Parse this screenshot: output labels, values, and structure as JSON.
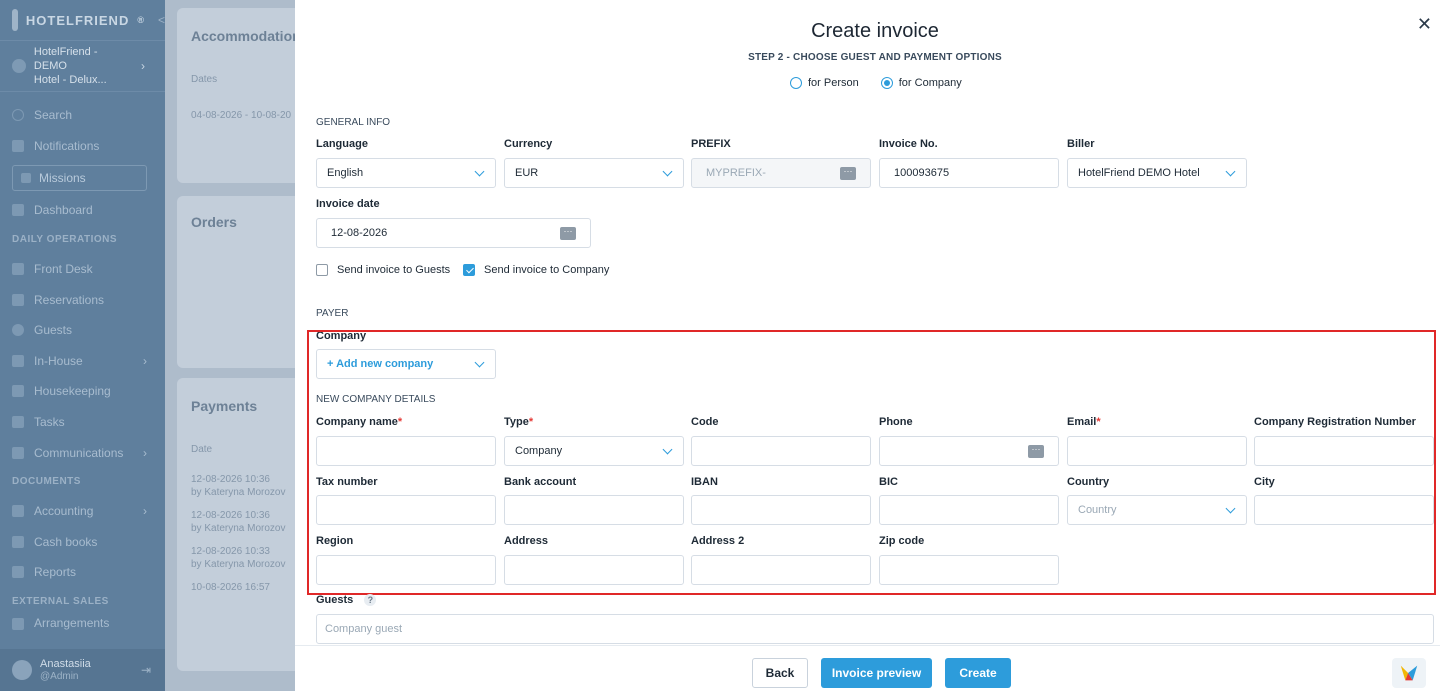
{
  "app": {
    "logo_text": "HOTELFRIEND",
    "logo_suffix": "®"
  },
  "sidebar": {
    "hotel": "HotelFriend - DEMO Hotel - Delux...",
    "hotel_line1": "HotelFriend - DEMO",
    "hotel_line2": "Hotel - Delux...",
    "items_top": [
      {
        "label": "Search",
        "icon": "search-icon"
      },
      {
        "label": "Notifications",
        "icon": "bell-icon"
      }
    ],
    "missions": "Missions",
    "dashboard": "Dashboard",
    "section_daily": "DAILY OPERATIONS",
    "items_daily": [
      {
        "label": "Front Desk",
        "icon": "front-desk-icon"
      },
      {
        "label": "Reservations",
        "icon": "calendar-icon"
      },
      {
        "label": "Guests",
        "icon": "user-icon"
      },
      {
        "label": "In-House",
        "icon": "bed-icon",
        "chevron": true
      },
      {
        "label": "Housekeeping",
        "icon": "broom-icon"
      },
      {
        "label": "Tasks",
        "icon": "wrench-icon"
      },
      {
        "label": "Communications",
        "icon": "chat-icon",
        "chevron": true
      }
    ],
    "section_documents": "DOCUMENTS",
    "items_documents": [
      {
        "label": "Accounting",
        "icon": "chart-icon",
        "chevron": true
      },
      {
        "label": "Cash books",
        "icon": "book-icon"
      },
      {
        "label": "Reports",
        "icon": "report-icon"
      }
    ],
    "section_external": "EXTERNAL SALES",
    "items_external": [
      {
        "label": "Arrangements",
        "icon": "arrangement-icon"
      }
    ],
    "user": {
      "name": "Anastasiia",
      "role": "@Admin"
    }
  },
  "background": {
    "accommodation": {
      "title": "Accommodation",
      "head": "Dates",
      "row": "04-08-2026 - 10-08-20"
    },
    "orders": {
      "title": "Orders"
    },
    "payments": {
      "title": "Payments",
      "head": "Date",
      "rows": [
        {
          "date": "12-08-2026 10:36",
          "by": "by Kateryna Morozov"
        },
        {
          "date": "12-08-2026 10:36",
          "by": "by Kateryna Morozov"
        },
        {
          "date": "12-08-2026 10:33",
          "by": "by Kateryna Morozov"
        },
        {
          "date": "10-08-2026 16:57",
          "by": ""
        }
      ]
    }
  },
  "modal": {
    "title": "Create invoice",
    "step": "STEP 2 - CHOOSE GUEST AND PAYMENT OPTIONS",
    "radio_person": "for Person",
    "radio_company": "for Company",
    "selected_radio": "for Company",
    "general_info": "GENERAL INFO",
    "labels": {
      "language": "Language",
      "currency": "Currency",
      "prefix": "PREFIX",
      "invoice_no": "Invoice No.",
      "biller": "Biller",
      "invoice_date": "Invoice date"
    },
    "values": {
      "language": "English",
      "currency": "EUR",
      "prefix_placeholder": "MYPREFIX-",
      "invoice_no": "100093675",
      "biller": "HotelFriend DEMO Hotel",
      "invoice_date": "12-08-2026"
    },
    "send_guests": "Send invoice to Guests",
    "send_company": "Send invoice to Company",
    "send_guests_checked": false,
    "send_company_checked": true,
    "payer": "PAYER",
    "company_label": "Company",
    "add_company": "+ Add new company",
    "new_company_details": "NEW COMPANY DETAILS",
    "company_fields": {
      "company_name": "Company name",
      "type": "Type",
      "code": "Code",
      "phone": "Phone",
      "email": "Email",
      "reg_number": "Company Registration Number",
      "tax_number": "Tax number",
      "bank_account": "Bank account",
      "iban": "IBAN",
      "bic": "BIC",
      "country": "Country",
      "city": "City",
      "region": "Region",
      "address": "Address",
      "address2": "Address 2",
      "zip": "Zip code"
    },
    "required_mark": "*",
    "type_value": "Company",
    "country_placeholder": "Country",
    "guests_label": "Guests",
    "guests_help": "?",
    "guests_placeholder": "Company guest",
    "buttons": {
      "back": "Back",
      "preview": "Invoice preview",
      "create": "Create"
    },
    "close": "✕"
  },
  "colors": {
    "accent": "#2d9cdb",
    "highlight": "#e02828",
    "sidebar": "#5f7f9d"
  }
}
